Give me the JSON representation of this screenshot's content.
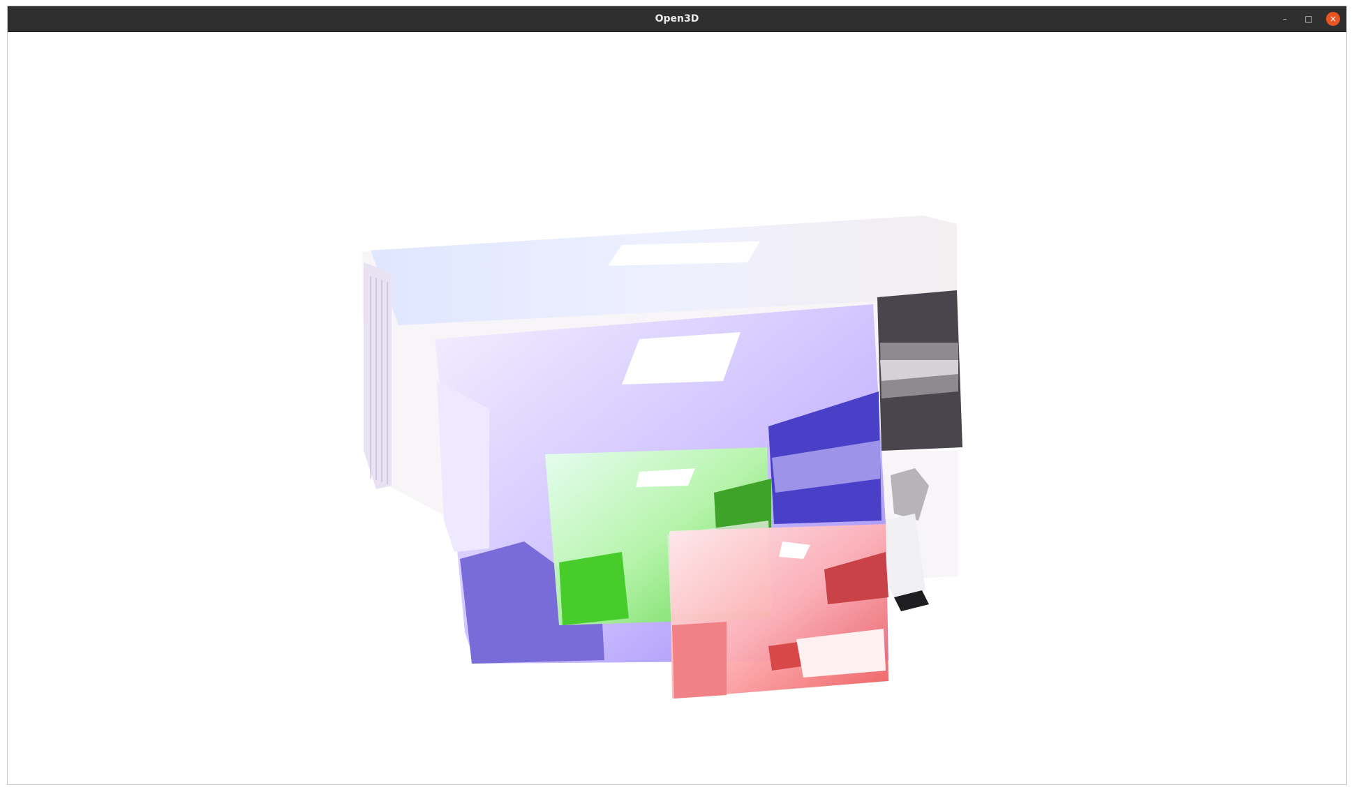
{
  "window": {
    "title": "Open3D",
    "controls": {
      "minimize_icon": "–",
      "maximize_icon": "□",
      "close_icon": "×"
    }
  },
  "scene": {
    "background": "#ffffff",
    "description_colors": {
      "scene_tint": "#f4ecff",
      "blue_tint": "#7f6df0",
      "green_tint": "#4ccd3a",
      "red_tint": "#e8454a",
      "close_accent": "#e95420"
    }
  }
}
